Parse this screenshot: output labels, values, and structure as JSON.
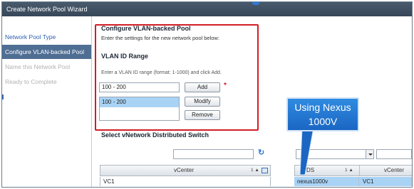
{
  "window": {
    "title": "Create Network Pool Wizard"
  },
  "nav": {
    "items": [
      {
        "label": "Network Pool Type",
        "state": "link"
      },
      {
        "label": "Configure VLAN-backed Pool",
        "state": "active"
      },
      {
        "label": "Name this Network Pool",
        "state": "disabled"
      },
      {
        "label": "Ready to Complete",
        "state": "disabled"
      }
    ]
  },
  "page": {
    "heading": "Configure VLAN-backed Pool",
    "intro": "Enter the settings for the new network pool below:",
    "vlan_section_title": "VLAN ID Range",
    "vlan_hint": "Enter a VLAN ID range (format: 1-1000) and click Add.",
    "range_input_value": "100 - 200",
    "ranges": [
      "100 - 200"
    ],
    "buttons": {
      "add": "Add",
      "modify": "Modify",
      "remove": "Remove"
    },
    "required_marker": "*"
  },
  "switch_section": {
    "title": "Select vNetwork Distributed Switch",
    "left_grid": {
      "columns": [
        "vCenter"
      ],
      "sort_indicator": "1 ▲",
      "rows": [
        [
          "VC1"
        ]
      ]
    },
    "right_grid": {
      "columns": [
        "vDS",
        "vCenter"
      ],
      "sort_indicator": "1 ▲",
      "rows": [
        [
          "nexus1000v",
          "VC1"
        ]
      ]
    }
  },
  "callout": {
    "line1": "Using Nexus",
    "line2": "1000V"
  },
  "colors": {
    "highlight": "#d11d24",
    "callout": "#1f74cf",
    "selection": "#a9d3f5",
    "titlebar": "#3f5064"
  }
}
